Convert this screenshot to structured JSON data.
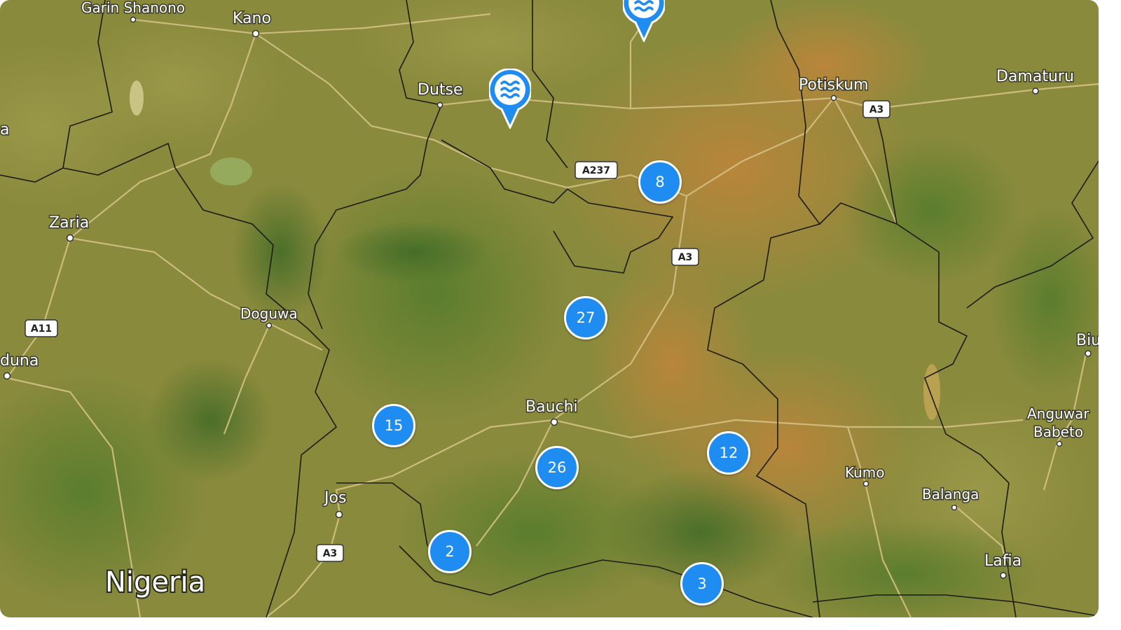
{
  "map": {
    "country_label": "Nigeria",
    "cities": [
      {
        "name": "Garin Shanono"
      },
      {
        "name": "Kano"
      },
      {
        "name": "Dutse"
      },
      {
        "name": "Potiskum"
      },
      {
        "name": "Damaturu"
      },
      {
        "name": "Zaria"
      },
      {
        "name": "Doguwa"
      },
      {
        "name": "duna"
      },
      {
        "name": "Bauchi"
      },
      {
        "name": "Jos"
      },
      {
        "name": "Kumo"
      },
      {
        "name": "Balanga"
      },
      {
        "name": "Anguwar"
      },
      {
        "name": "Babeto"
      },
      {
        "name": "Lafia"
      },
      {
        "name": "Biu"
      },
      {
        "name": "a"
      }
    ],
    "road_shields": [
      "A3",
      "A237",
      "A3",
      "A11",
      "A3"
    ],
    "clusters": [
      {
        "count": "8"
      },
      {
        "count": "27"
      },
      {
        "count": "15"
      },
      {
        "count": "26"
      },
      {
        "count": "12"
      },
      {
        "count": "2"
      },
      {
        "count": "3"
      }
    ],
    "markers": [
      {
        "icon": "water-icon",
        "color": "#1e8cf0"
      },
      {
        "icon": "water-icon",
        "color": "#1e8cf0"
      }
    ],
    "colors": {
      "cluster": "#1e8cf0",
      "land_base": "#8a8a38"
    }
  }
}
